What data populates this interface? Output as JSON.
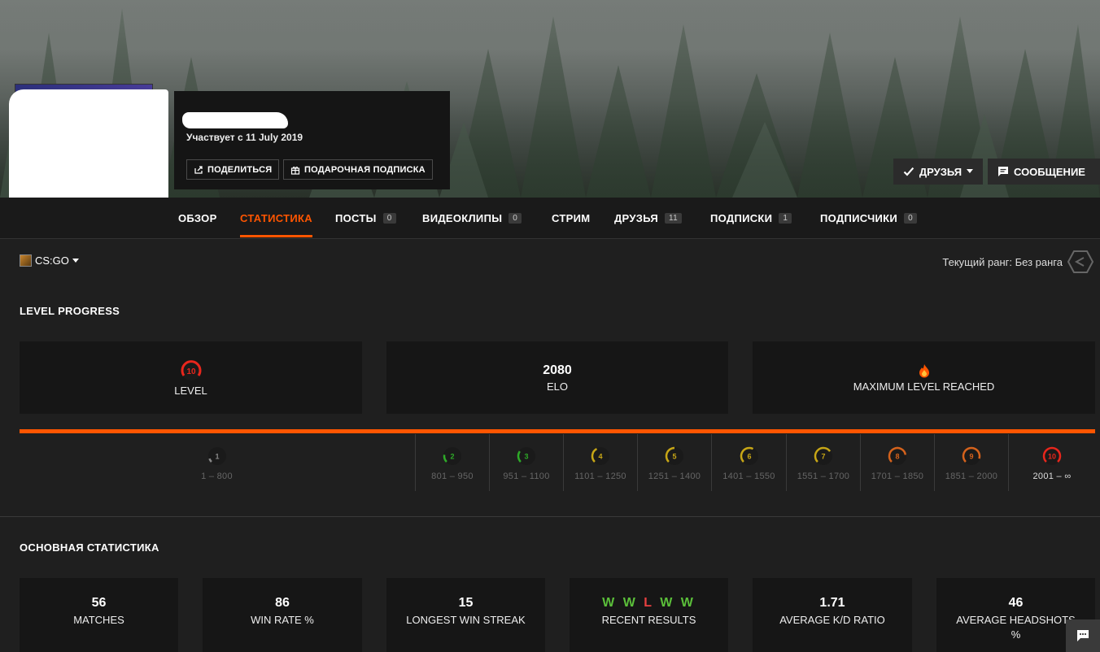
{
  "profile": {
    "member_since": "Участвует с 11 July 2019",
    "share_label": "ПОДЕЛИТЬСЯ",
    "gift_label": "ПОДАРОЧНАЯ ПОДПИСКА",
    "friends_label": "ДРУЗЬЯ",
    "message_label": "СООБЩЕНИЕ"
  },
  "nav": {
    "tabs": [
      {
        "label": "ОБЗОР"
      },
      {
        "label": "СТАТИСТИКА"
      },
      {
        "label": "ПОСТЫ",
        "count": "0"
      },
      {
        "label": "ВИДЕОКЛИПЫ",
        "count": "0"
      },
      {
        "label": "СТРИМ"
      },
      {
        "label": "ДРУЗЬЯ",
        "count": "11"
      },
      {
        "label": "ПОДПИСКИ",
        "count": "1"
      },
      {
        "label": "ПОДПИСЧИКИ",
        "count": "0"
      }
    ]
  },
  "game": {
    "label": "CS:GO"
  },
  "rank": {
    "label": "Текущий ранг: Без ранга"
  },
  "level_progress": {
    "title": "LEVEL PROGRESS",
    "level_value": "10",
    "level_label": "LEVEL",
    "elo_value": "2080",
    "elo_label": "ELO",
    "max_label": "MAXIMUM LEVEL REACHED",
    "levels": [
      {
        "n": "1",
        "range": "1 – 800",
        "color": "#888888"
      },
      {
        "n": "2",
        "range": "801 – 950",
        "color": "#2eaa28"
      },
      {
        "n": "3",
        "range": "951 – 1100",
        "color": "#2eaa28"
      },
      {
        "n": "4",
        "range": "1101 – 1250",
        "color": "#c7a616"
      },
      {
        "n": "5",
        "range": "1251 – 1400",
        "color": "#c7a616"
      },
      {
        "n": "6",
        "range": "1401 – 1550",
        "color": "#c7a616"
      },
      {
        "n": "7",
        "range": "1551 – 1700",
        "color": "#c7a616"
      },
      {
        "n": "8",
        "range": "1701 – 1850",
        "color": "#d4621c"
      },
      {
        "n": "9",
        "range": "1851 – 2000",
        "color": "#d4621c"
      },
      {
        "n": "10",
        "range": "2001 – ∞",
        "color": "#e8261c"
      }
    ]
  },
  "main_stats": {
    "title": "ОСНОВНАЯ СТАТИСТИКА",
    "matches_value": "56",
    "matches_label": "MATCHES",
    "winrate_value": "86",
    "winrate_label": "WIN RATE %",
    "streak_value": "15",
    "streak_label": "LONGEST WIN STREAK",
    "recent_results": [
      "W",
      "W",
      "L",
      "W",
      "W"
    ],
    "recent_label": "RECENT RESULTS",
    "kd_value": "1.71",
    "kd_label": "AVERAGE K/D RATIO",
    "hs_value": "46",
    "hs_label": "AVERAGE HEADSHOTS %"
  },
  "icons": [
    "share-icon",
    "gift-icon",
    "check-icon",
    "caret-down-icon",
    "message-icon",
    "game-icon",
    "rank-icon",
    "fire-icon",
    "chat-icon"
  ]
}
